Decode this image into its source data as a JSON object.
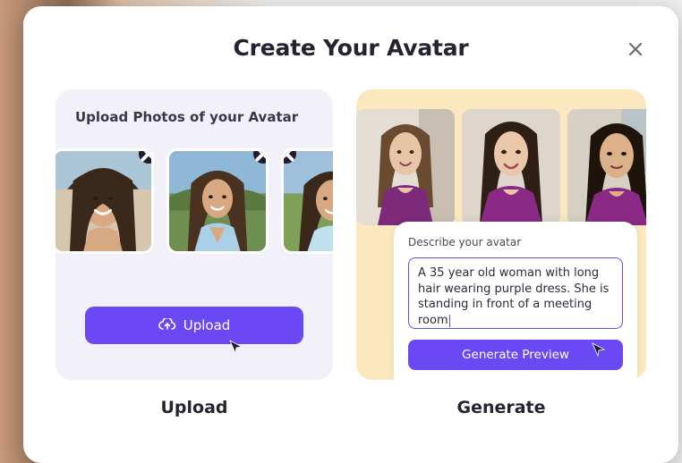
{
  "modal": {
    "title": "Create Your Avatar"
  },
  "upload": {
    "heading": "Upload Photos of your Avatar",
    "button_label": "Upload",
    "option_label": "Upload"
  },
  "generate": {
    "prompt_label": "Describe your avatar",
    "prompt_text": "A 35 year old woman with long hair wearing purple dress. She is standing in front of a meeting room",
    "button_label": "Generate Preview",
    "option_label": "Generate"
  },
  "colors": {
    "accent": "#6a49f5",
    "upload_card_bg": "#f2f0f9",
    "generate_card_bg": "#fce8bf"
  }
}
